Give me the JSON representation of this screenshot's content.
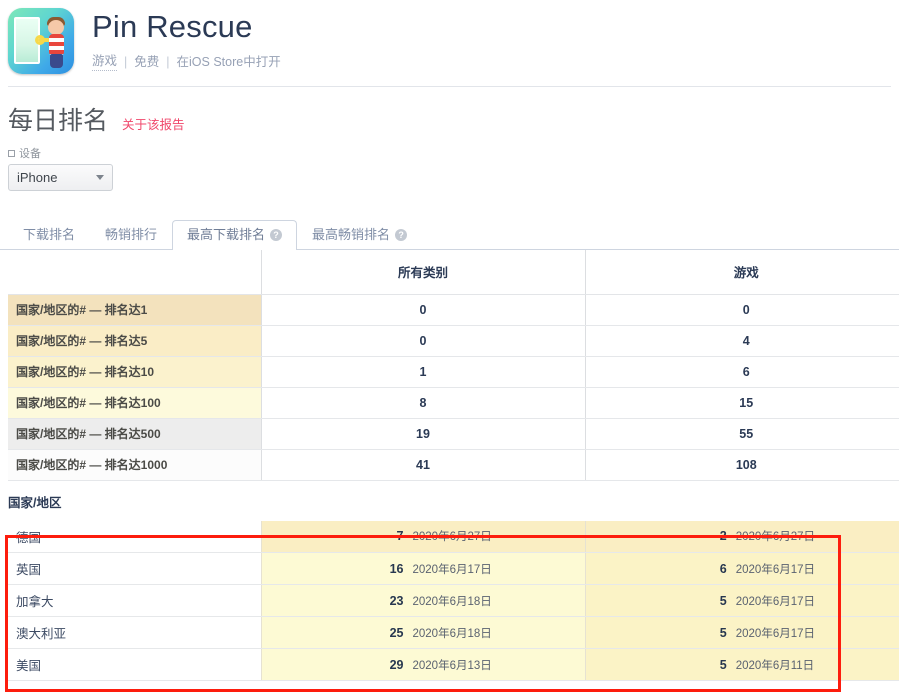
{
  "app": {
    "name": "Pin Rescue",
    "icon_name": "pin-rescue-app-icon",
    "category": "游戏",
    "price": "免费",
    "store_link": "在iOS Store中打开",
    "sep": "|"
  },
  "report": {
    "title": "每日排名",
    "about_link": "关于该报告"
  },
  "device_filter": {
    "label": "设备",
    "value": "iPhone"
  },
  "tabs": [
    {
      "label": "下载排名",
      "active": false,
      "has_help": false
    },
    {
      "label": "畅销排行",
      "active": false,
      "has_help": false
    },
    {
      "label": "最高下载排名",
      "active": true,
      "has_help": true
    },
    {
      "label": "最高畅销排名",
      "active": false,
      "has_help": true
    }
  ],
  "help_glyph": "?",
  "threshold_table": {
    "headers": {
      "label": "",
      "all_categories": "所有类别",
      "games": "游戏"
    },
    "rows": [
      {
        "label": "国家/地区的# — 排名达1",
        "all_categories": "0",
        "games": "0"
      },
      {
        "label": "国家/地区的# — 排名达5",
        "all_categories": "0",
        "games": "4"
      },
      {
        "label": "国家/地区的# — 排名达10",
        "all_categories": "1",
        "games": "6"
      },
      {
        "label": "国家/地区的# — 排名达100",
        "all_categories": "8",
        "games": "15"
      },
      {
        "label": "国家/地区的# — 排名达500",
        "all_categories": "19",
        "games": "55"
      },
      {
        "label": "国家/地区的# — 排名达1000",
        "all_categories": "41",
        "games": "108"
      }
    ]
  },
  "country_section": {
    "title": "国家/地区",
    "rows": [
      {
        "country": "德国",
        "all_rank": "7",
        "all_date": "2020年6月27日",
        "games_rank": "2",
        "games_date": "2020年6月27日"
      },
      {
        "country": "英国",
        "all_rank": "16",
        "all_date": "2020年6月17日",
        "games_rank": "6",
        "games_date": "2020年6月17日"
      },
      {
        "country": "加拿大",
        "all_rank": "23",
        "all_date": "2020年6月18日",
        "games_rank": "5",
        "games_date": "2020年6月17日"
      },
      {
        "country": "澳大利亚",
        "all_rank": "25",
        "all_date": "2020年6月18日",
        "games_rank": "5",
        "games_date": "2020年6月17日"
      },
      {
        "country": "美国",
        "all_rank": "29",
        "all_date": "2020年6月13日",
        "games_rank": "5",
        "games_date": "2020年6月11日"
      }
    ]
  },
  "colors": {
    "highlight_box": "#fd1d0d",
    "link_pink": "#f0476b",
    "value_navy": "#2b3a55",
    "row_amber_1": "#f3e2bd",
    "row_amber_2": "#faedc6",
    "row_amber_3": "#fbf2cd",
    "row_amber_4": "#fdfadc",
    "row_gray": "#ededed",
    "row_white": "#ffffff",
    "cell_yellow_dark": "#faeec3",
    "cell_yellow_light": "#fcf7d2"
  }
}
